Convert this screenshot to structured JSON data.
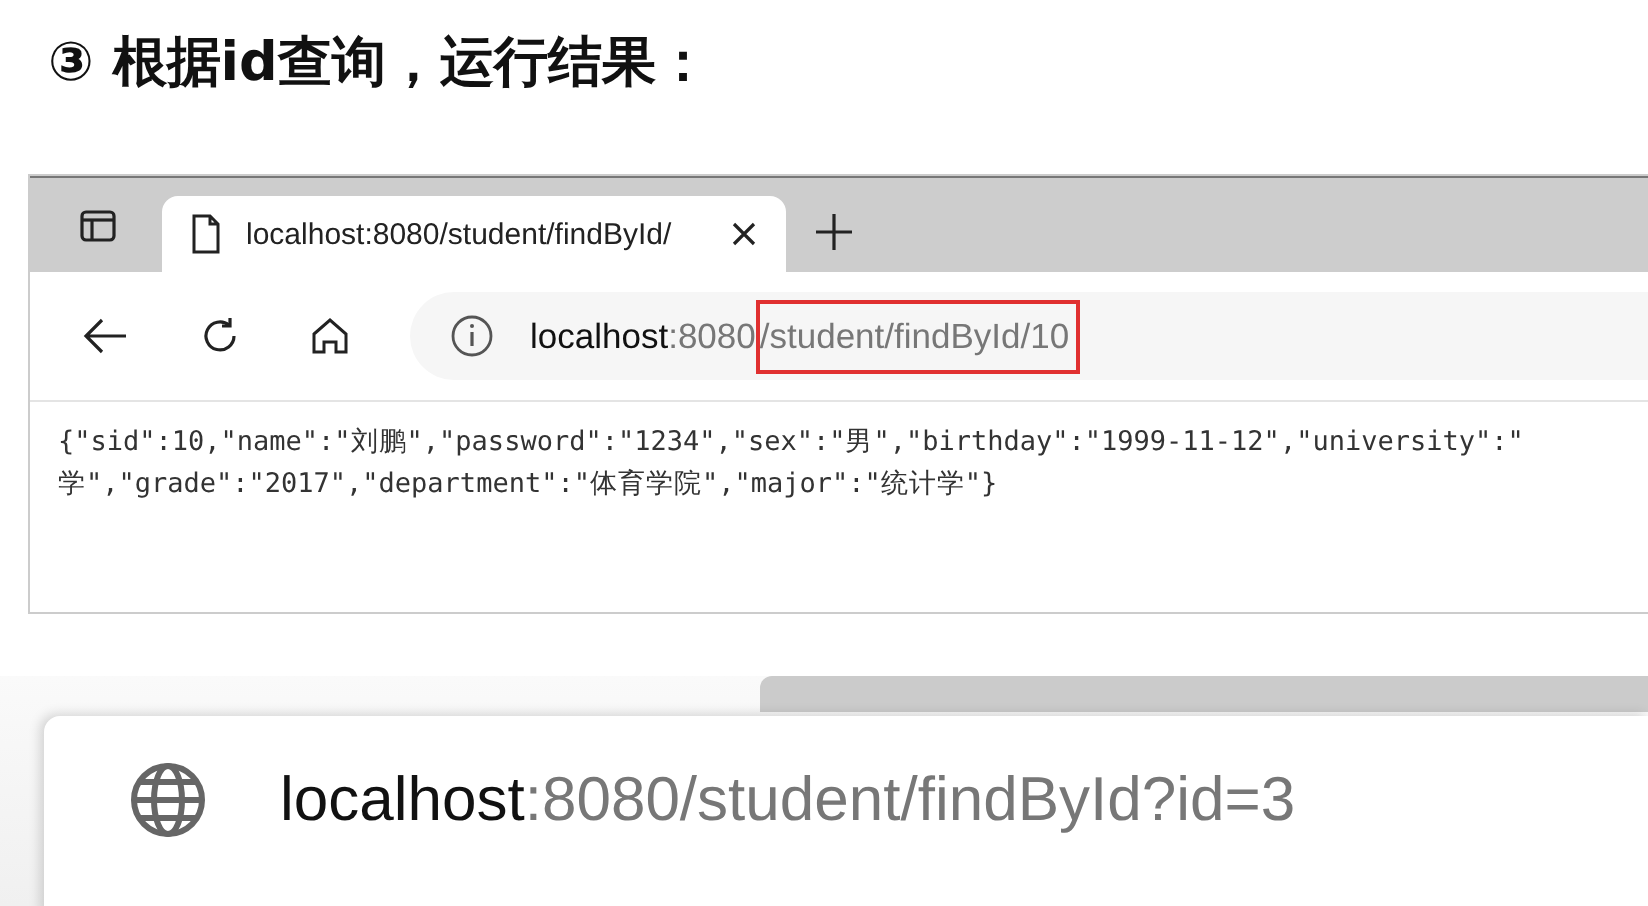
{
  "heading": "③ 根据id查询，运行结果：",
  "browser": {
    "tab": {
      "title": "localhost:8080/student/findById/",
      "selected": true
    },
    "address": {
      "host": "localhost",
      "port": ":8080",
      "path": "/student/findById/10",
      "highlighted": true
    },
    "content_lines": [
      "{\"sid\":10,\"name\":\"刘鹏\",\"password\":\"1234\",\"sex\":\"男\",\"birthday\":\"1999-11-12\",\"university\":\"",
      "学\",\"grade\":\"2017\",\"department\":\"体育学院\",\"major\":\"统计学\"}"
    ]
  },
  "suggestion": {
    "host": "localhost",
    "rest": ":8080/student/findById?id=3"
  }
}
